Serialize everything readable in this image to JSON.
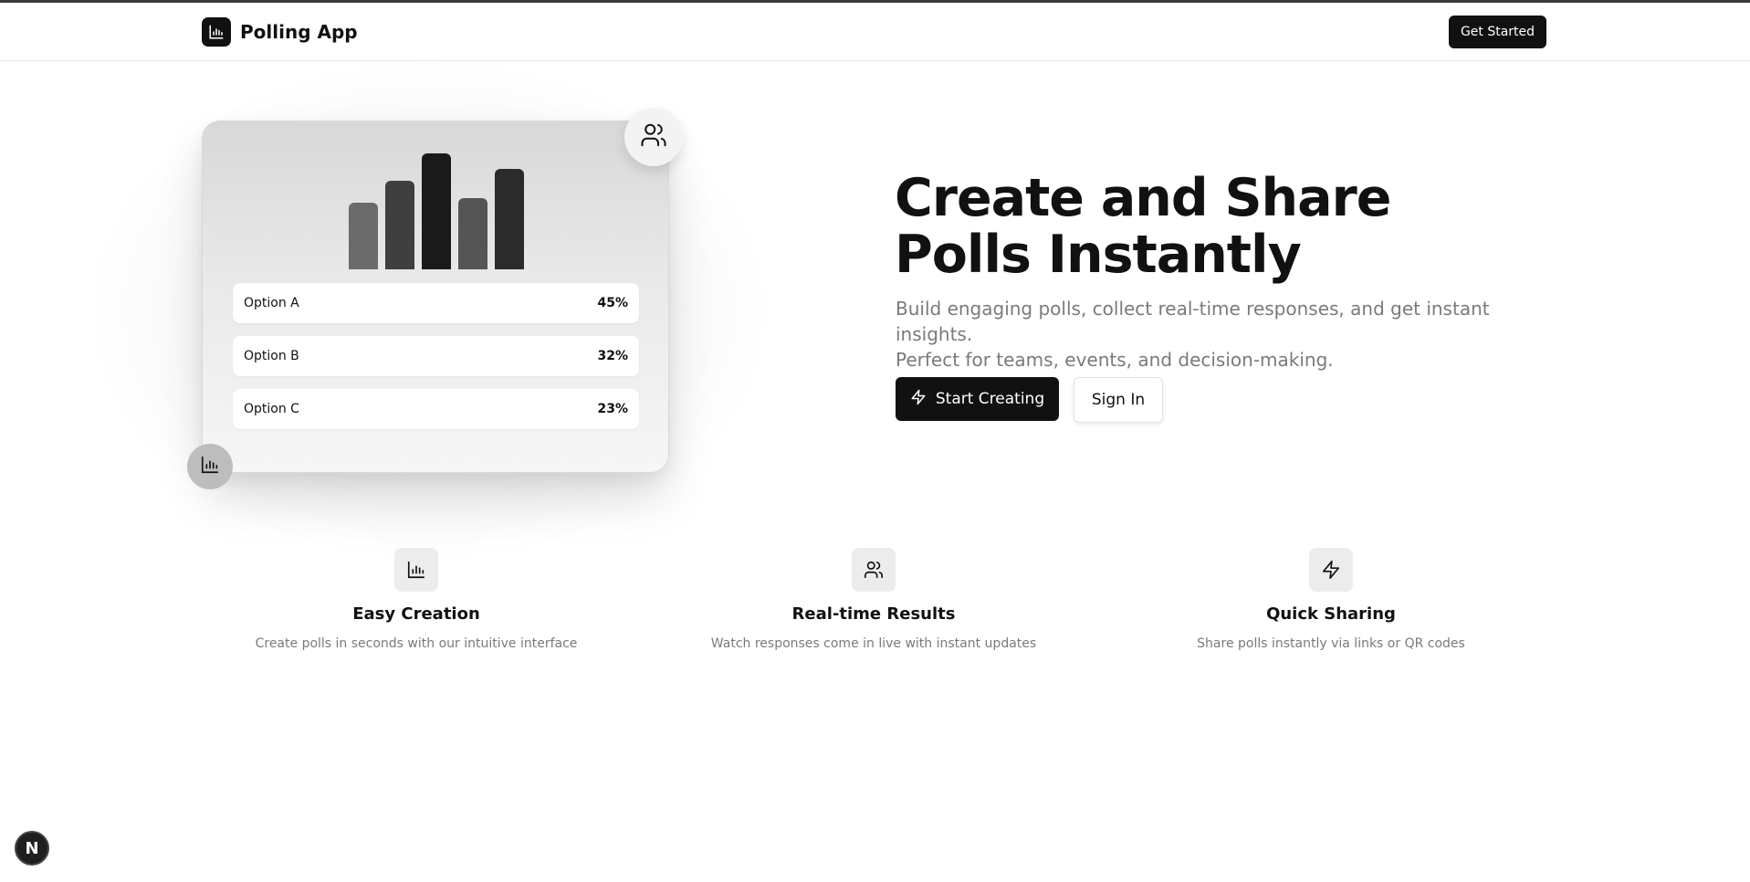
{
  "header": {
    "brand_name": "Polling App",
    "brand_icon": "bar-chart-icon",
    "cta_label": "Get Started"
  },
  "preview_card": {
    "chart_data": {
      "type": "bar",
      "values": [
        45,
        60,
        78,
        48,
        68
      ],
      "colors": [
        "#6b6b6b",
        "#3f3f3f",
        "#1a1a1a",
        "#555555",
        "#2b2b2b"
      ]
    },
    "options": [
      {
        "label": "Option A",
        "percent": "45%"
      },
      {
        "label": "Option B",
        "percent": "32%"
      },
      {
        "label": "Option C",
        "percent": "23%"
      }
    ],
    "top_badge_icon": "users-icon",
    "bottom_badge_icon": "bar-chart-icon"
  },
  "hero": {
    "title_line1": "Create and Share",
    "title_line2": "Polls Instantly",
    "subtitle_line1": "Build engaging polls, collect real-time responses, and get instant insights.",
    "subtitle_line2": "Perfect for teams, events, and decision-making.",
    "primary_button": "Start Creating",
    "primary_button_icon": "zap-icon",
    "secondary_button": "Sign In"
  },
  "features": [
    {
      "icon": "bar-chart-icon",
      "title": "Easy Creation",
      "description": "Create polls in seconds with our intuitive interface"
    },
    {
      "icon": "users-icon",
      "title": "Real-time Results",
      "description": "Watch responses come in live with instant updates"
    },
    {
      "icon": "zap-icon",
      "title": "Quick Sharing",
      "description": "Share polls instantly via links or QR codes"
    }
  ],
  "dev_badge": {
    "letter": "N"
  },
  "colors": {
    "primary": "#111111",
    "muted_text": "#7a7a7a",
    "icon_bg": "#ececec"
  }
}
